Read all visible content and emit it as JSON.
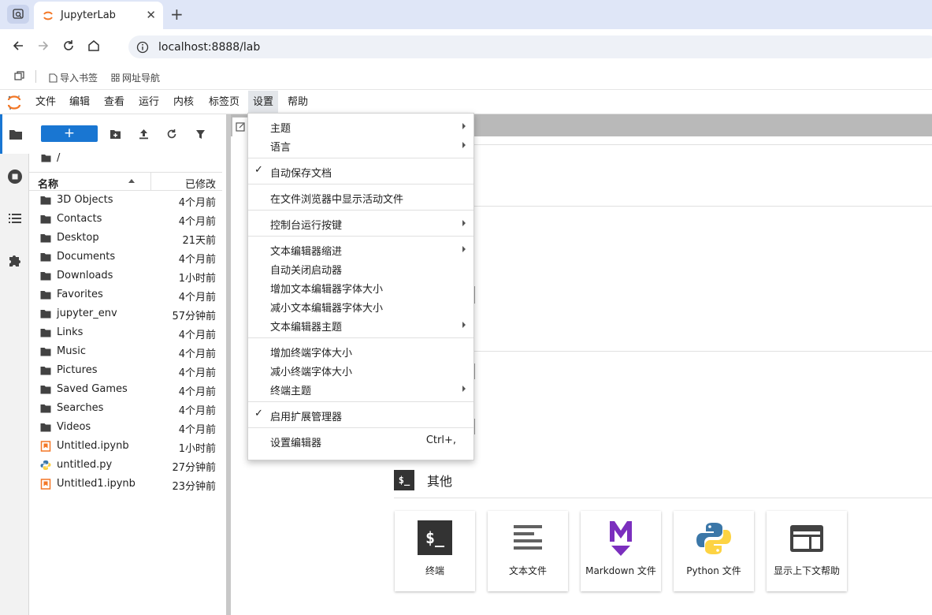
{
  "browser": {
    "tab_title": "JupyterLab",
    "url": "localhost:8888/lab",
    "bookmarks": [
      {
        "label": "导入书签",
        "icon": "bookmark-import-icon"
      },
      {
        "label": "网址导航",
        "icon": "grid-icon"
      }
    ]
  },
  "menubar": {
    "items": [
      "文件",
      "编辑",
      "查看",
      "运行",
      "内核",
      "标签页",
      "设置",
      "帮助"
    ],
    "active": "设置"
  },
  "filebrowser": {
    "breadcrumb": "/",
    "header_name": "名称",
    "header_modified": "已修改",
    "files": [
      {
        "name": "3D Objects",
        "modified": "4个月前",
        "type": "folder"
      },
      {
        "name": "Contacts",
        "modified": "4个月前",
        "type": "folder"
      },
      {
        "name": "Desktop",
        "modified": "21天前",
        "type": "folder"
      },
      {
        "name": "Documents",
        "modified": "4个月前",
        "type": "folder"
      },
      {
        "name": "Downloads",
        "modified": "1小时前",
        "type": "folder"
      },
      {
        "name": "Favorites",
        "modified": "4个月前",
        "type": "folder"
      },
      {
        "name": "jupyter_env",
        "modified": "57分钟前",
        "type": "folder"
      },
      {
        "name": "Links",
        "modified": "4个月前",
        "type": "folder"
      },
      {
        "name": "Music",
        "modified": "4个月前",
        "type": "folder"
      },
      {
        "name": "Pictures",
        "modified": "4个月前",
        "type": "folder"
      },
      {
        "name": "Saved Games",
        "modified": "4个月前",
        "type": "folder"
      },
      {
        "name": "Searches",
        "modified": "4个月前",
        "type": "folder"
      },
      {
        "name": "Videos",
        "modified": "4个月前",
        "type": "folder"
      },
      {
        "name": "Untitled.ipynb",
        "modified": "1小时前",
        "type": "notebook"
      },
      {
        "name": "untitled.py",
        "modified": "27分钟前",
        "type": "python"
      },
      {
        "name": "Untitled1.ipynb",
        "modified": "23分钟前",
        "type": "notebook"
      }
    ]
  },
  "settings_menu": {
    "groups": [
      [
        {
          "label": "主题",
          "submenu": true
        },
        {
          "label": "语言",
          "submenu": true
        }
      ],
      [
        {
          "label": "自动保存文档",
          "checked": true
        }
      ],
      [
        {
          "label": "在文件浏览器中显示活动文件"
        }
      ],
      [
        {
          "label": "控制台运行按键",
          "submenu": true
        }
      ],
      [
        {
          "label": "文本编辑器缩进",
          "submenu": true
        },
        {
          "label": "自动关闭启动器"
        },
        {
          "label": "增加文本编辑器字体大小"
        },
        {
          "label": "减小文本编辑器字体大小"
        },
        {
          "label": "文本编辑器主题",
          "submenu": true
        }
      ],
      [
        {
          "label": "增加终端字体大小"
        },
        {
          "label": "减小终端字体大小"
        },
        {
          "label": "终端主题",
          "submenu": true
        }
      ],
      [
        {
          "label": "启用扩展管理器",
          "checked": true
        }
      ],
      [
        {
          "label": "设置编辑器",
          "shortcut": "Ctrl+,"
        }
      ]
    ]
  },
  "launcher": {
    "section_title": "其他",
    "section_icon_text": "$_",
    "cards": [
      {
        "label": "终端",
        "icon": "terminal-icon",
        "icon_text": "$_"
      },
      {
        "label": "文本文件",
        "icon": "text-file-icon"
      },
      {
        "label": "Markdown 文件",
        "icon": "markdown-icon",
        "icon_text": "M"
      },
      {
        "label": "Python 文件",
        "icon": "python-icon"
      },
      {
        "label": "显示上下文帮助",
        "icon": "context-help-icon"
      }
    ]
  },
  "colors": {
    "accent": "#1976d2",
    "jupyter_orange": "#f37726",
    "markdown_purple": "#7b2fbe"
  }
}
